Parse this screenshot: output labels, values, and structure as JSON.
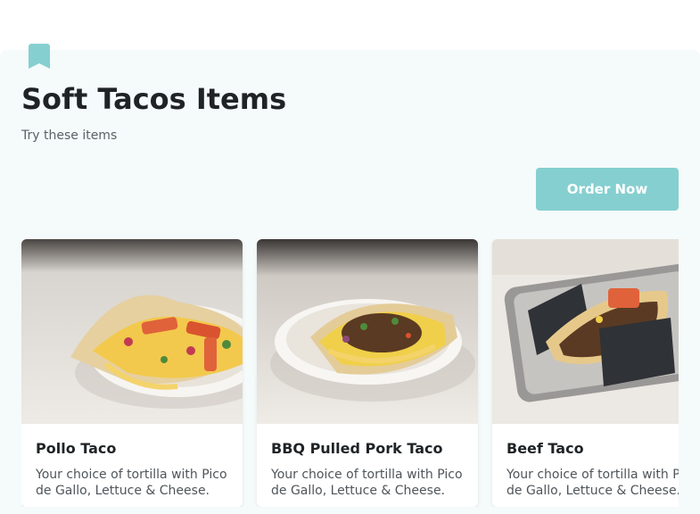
{
  "header": {
    "icon": "bookmark-icon",
    "title": "Soft Tacos Items",
    "subtitle": "Try these items",
    "order_label": "Order Now"
  },
  "colors": {
    "accent": "#86cfd0",
    "panel_bg": "#f5fafa",
    "title_text": "#1f2326"
  },
  "items": [
    {
      "name": "Pollo Taco",
      "description": "Your choice of tortilla with Pico de Gallo, Lettuce & Cheese."
    },
    {
      "name": "BBQ Pulled Pork Taco",
      "description": "Your choice of tortilla with Pico de Gallo, Lettuce & Cheese."
    },
    {
      "name": "Beef Taco",
      "description": "Your choice of tortilla with Pico de Gallo, Lettuce & Cheese."
    }
  ]
}
